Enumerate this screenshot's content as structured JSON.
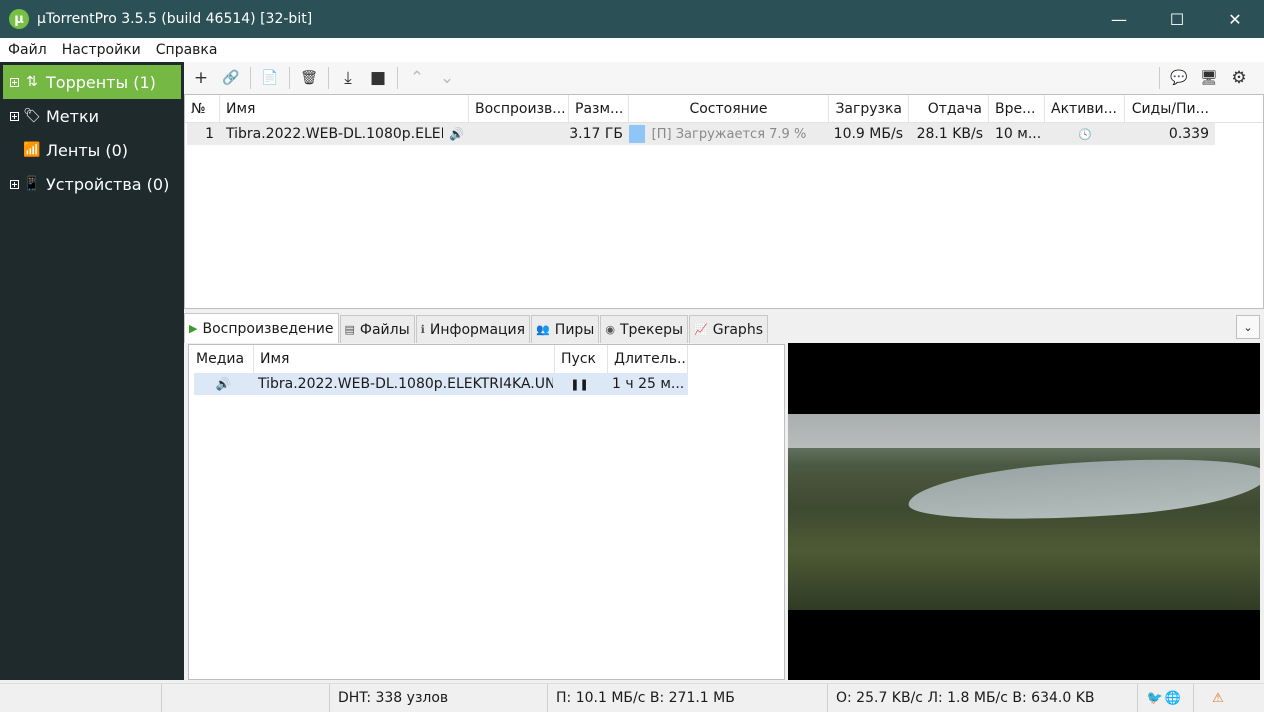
{
  "window": {
    "title": "µTorrentPro 3.5.5  (build 46514) [32-bit]",
    "logo_letter": "µ",
    "minimize": "—",
    "maximize": "☐",
    "close": "✕"
  },
  "menu": [
    "Файл",
    "Настройки",
    "Справка"
  ],
  "sidebar": {
    "items": [
      {
        "label": "Торренты (1)",
        "icon": "⇅"
      },
      {
        "label": "Метки",
        "icon": "🏷"
      },
      {
        "label": "Ленты (0)",
        "icon": "📶"
      },
      {
        "label": "Устройства (0)",
        "icon": "📱"
      }
    ]
  },
  "toolbar": {
    "add": "+",
    "add_url": "🔗",
    "create": "📄",
    "remove": "🗑",
    "start": "⤓",
    "stop": "■",
    "up": "⌃",
    "down": "⌄",
    "chat": "💬",
    "remote": "🖥",
    "settings": "⚙"
  },
  "torrents": {
    "columns": [
      "№",
      "Имя",
      "Воспроизв...",
      "Разм...",
      "Состояние",
      "Загрузка",
      "Отдача",
      "Вре...",
      "Активи...",
      "Сиды/Пи..."
    ],
    "rows": [
      {
        "num": "1",
        "name": "Tibra.2022.WEB-DL.1080p.ELEK...",
        "play_icon": "🔊",
        "size": "3.17 ГБ",
        "status": "[П] Загружается 7.9 %",
        "progress": 7.9,
        "download": "10.9 МБ/s",
        "upload": "28.1 KB/s",
        "time": "10 м...",
        "activity_icon": "🕓",
        "ratio": "0.339"
      }
    ]
  },
  "tabs": [
    {
      "label": "Воспроизведение",
      "icon": "▶"
    },
    {
      "label": "Файлы",
      "icon": "▤"
    },
    {
      "label": "Информация",
      "icon": "ℹ"
    },
    {
      "label": "Пиры",
      "icon": "👥"
    },
    {
      "label": "Трекеры",
      "icon": "◉"
    },
    {
      "label": "Graphs",
      "icon": "📈"
    }
  ],
  "collapse": "⌄",
  "playback": {
    "columns": [
      "Медиа",
      "Имя",
      "Пуск",
      "Длитель..."
    ],
    "rows": [
      {
        "media_icon": "🔊",
        "name": "Tibra.2022.WEB-DL.1080p.ELEKTRI4KA.UN...",
        "play_icon": "❚❚",
        "duration": "1 ч 25 м..."
      }
    ]
  },
  "statusbar": {
    "dht": "DHT: 338 узлов",
    "download": "П: 10.1 МБ/с В: 271.1 МБ",
    "upload": "О: 25.7 KB/с Л: 1.8 МБ/с В: 634.0 KB",
    "twitter": "🐦",
    "globe": "🌐",
    "warning": "⚠"
  },
  "colors": {
    "titlebar": "#2b5156",
    "sidebar": "#1e2a2c",
    "accent": "#75b843",
    "progress": "#8ec7f5",
    "selection": "#dde8f6"
  }
}
